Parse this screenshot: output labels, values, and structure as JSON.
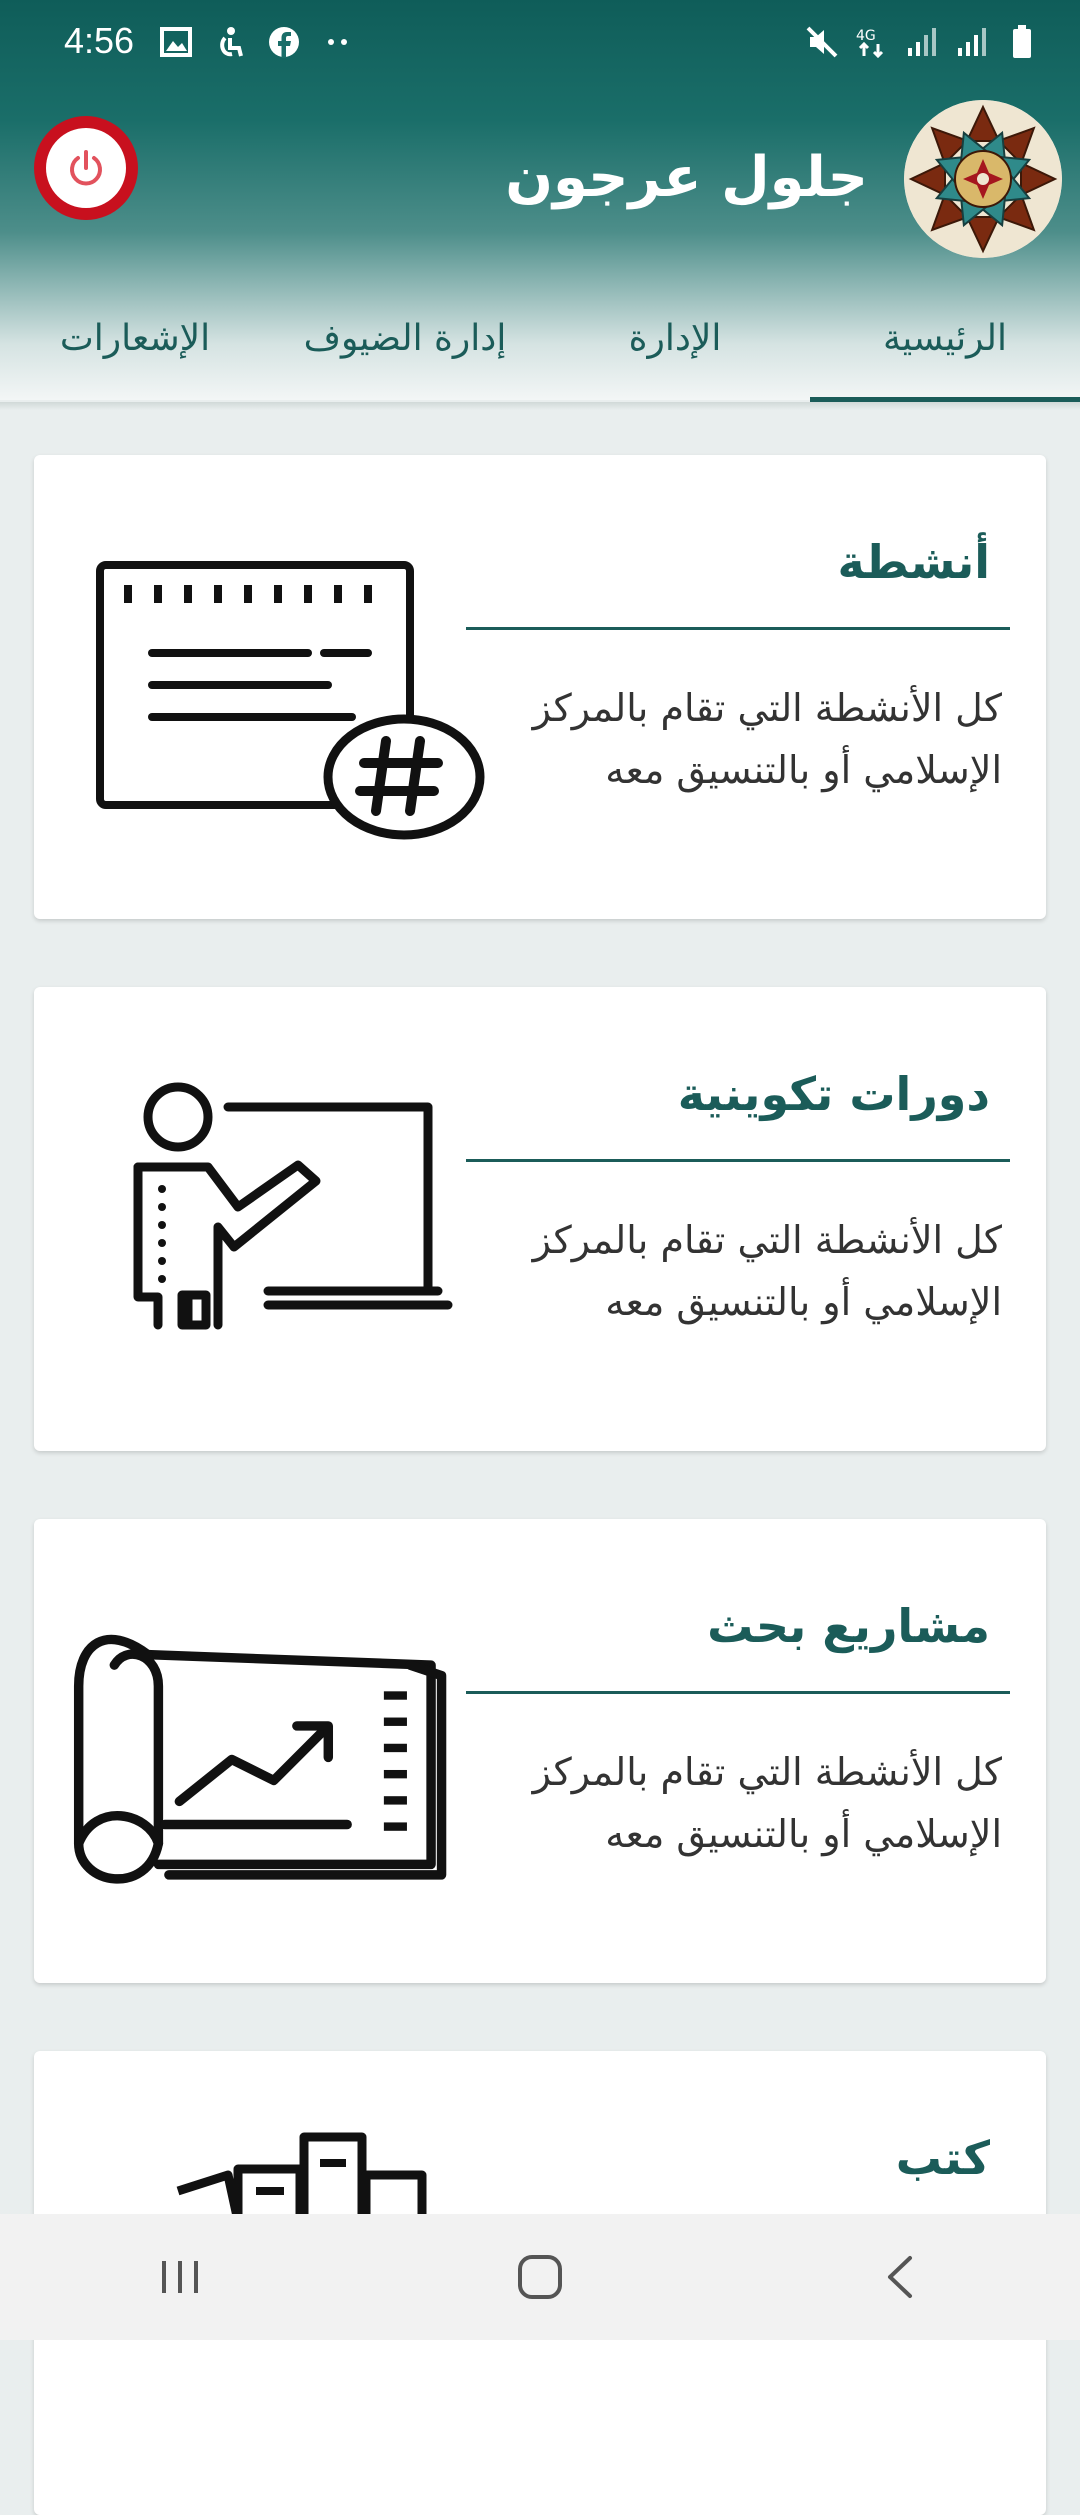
{
  "status": {
    "time": "4:56"
  },
  "header": {
    "title": "جلول عرجون"
  },
  "tabs": [
    {
      "label": "الرئيسية",
      "active": true
    },
    {
      "label": "الإدارة",
      "active": false
    },
    {
      "label": "إدارة الضيوف",
      "active": false
    },
    {
      "label": "الإشعارات",
      "active": false
    }
  ],
  "cards": [
    {
      "title": "أنشطة",
      "description": "كل الأنشطة التي تقام بالمركز الإسلامي أو بالتنسيق معه",
      "icon": "calendar-hashtag-icon"
    },
    {
      "title": "دورات تكوينية",
      "description": "كل الأنشطة التي تقام بالمركز الإسلامي أو بالتنسيق معه",
      "icon": "teacher-board-icon"
    },
    {
      "title": "مشاريع بحث",
      "description": "كل الأنشطة التي تقام بالمركز الإسلامي أو بالتنسيق معه",
      "icon": "blueprint-chart-icon"
    },
    {
      "title": "كتب",
      "description": "",
      "icon": "books-icon"
    }
  ],
  "colors": {
    "accent": "#1b5c59",
    "power": "#c8101e"
  }
}
